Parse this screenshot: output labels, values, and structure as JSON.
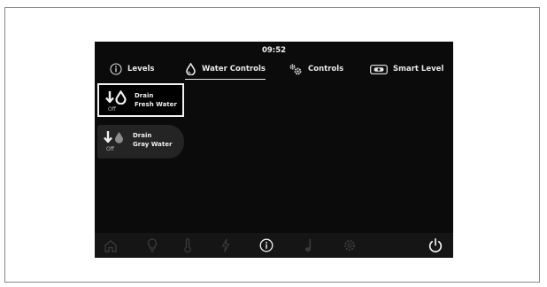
{
  "clock": {
    "time": "09:52"
  },
  "tabs": [
    {
      "label": "Levels",
      "icon": "info-circle-icon",
      "active": false
    },
    {
      "label": "Water Controls",
      "icon": "water-drop-icon",
      "active": true
    },
    {
      "label": "Controls",
      "icon": "gears-icon",
      "active": false
    },
    {
      "label": "Smart Level",
      "icon": "smart-level-icon",
      "active": false
    }
  ],
  "tiles": [
    {
      "line1": "Drain",
      "line2": "Fresh Water",
      "status": "Off",
      "icon": "drain-fresh-water-icon",
      "selected": true
    },
    {
      "line1": "Drain",
      "line2": "Gray Water",
      "status": "Off",
      "icon": "drain-gray-water-icon",
      "selected": false
    }
  ],
  "dock": [
    {
      "icon": "home-icon",
      "active": false
    },
    {
      "icon": "lightbulb-icon",
      "active": false
    },
    {
      "icon": "thermometer-icon",
      "active": false
    },
    {
      "icon": "power-bolt-icon",
      "active": false
    },
    {
      "icon": "info-icon",
      "active": true
    },
    {
      "icon": "music-note-icon",
      "active": false
    },
    {
      "icon": "settings-gear-icon",
      "active": false
    },
    {
      "icon": "power-button-icon",
      "active": true
    }
  ],
  "colors": {
    "screen_bg": "#0b0b0b",
    "text": "#f0f0f0",
    "dim_icon": "#3a3a3a",
    "tile_bg": "#242424"
  }
}
